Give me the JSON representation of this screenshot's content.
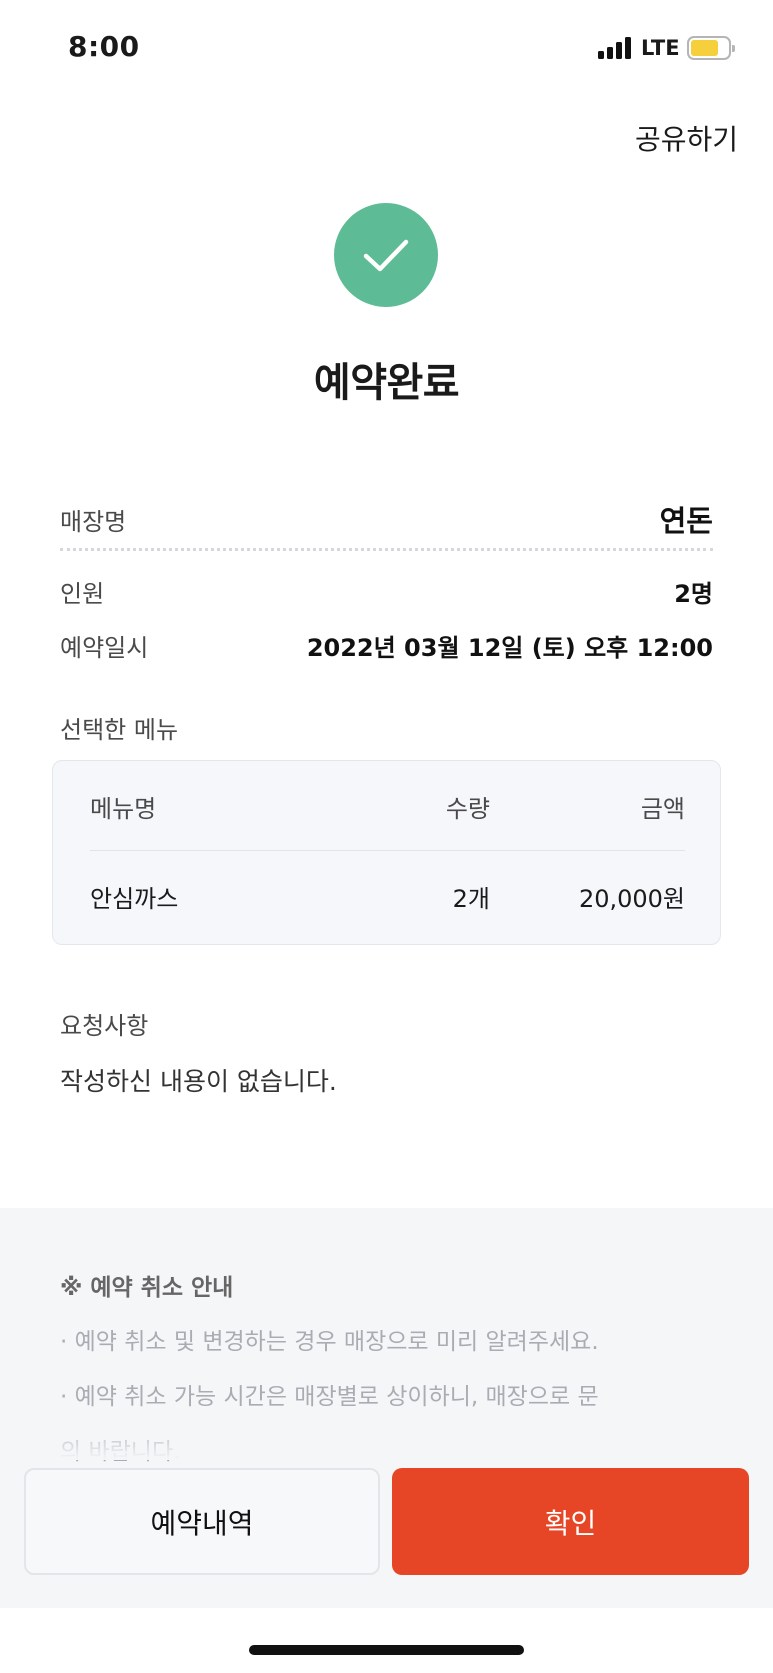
{
  "status_bar": {
    "time": "8:00",
    "network": "LTE",
    "battery_color": "#f5cf3c"
  },
  "header": {
    "share_label": "공유하기"
  },
  "success": {
    "icon": "check-icon",
    "title": "예약완료",
    "color": "#5dbb95"
  },
  "reservation": {
    "store_label": "매장명",
    "store_value": "연돈",
    "people_label": "인원",
    "people_value": "2명",
    "datetime_label": "예약일시",
    "datetime_value": "2022년 03월 12일 (토) 오후 12:00"
  },
  "menu": {
    "section_title": "선택한 메뉴",
    "headers": {
      "name": "메뉴명",
      "qty": "수량",
      "price": "금액"
    },
    "items": [
      {
        "name": "안심까스",
        "qty": "2개",
        "price": "20,000원"
      }
    ]
  },
  "request": {
    "title": "요청사항",
    "content": "작성하신 내용이 없습니다."
  },
  "notice": {
    "title": "※ 예약 취소 안내",
    "lines": [
      "· 예약 취소 및 변경하는 경우 매장으로 미리 알려주세요.",
      "· 예약 취소 가능 시간은 매장별로 상이하니, 매장으로 문",
      "의 바랍니다."
    ]
  },
  "buttons": {
    "history_label": "예약내역",
    "confirm_label": "확인",
    "confirm_color": "#e64626"
  }
}
